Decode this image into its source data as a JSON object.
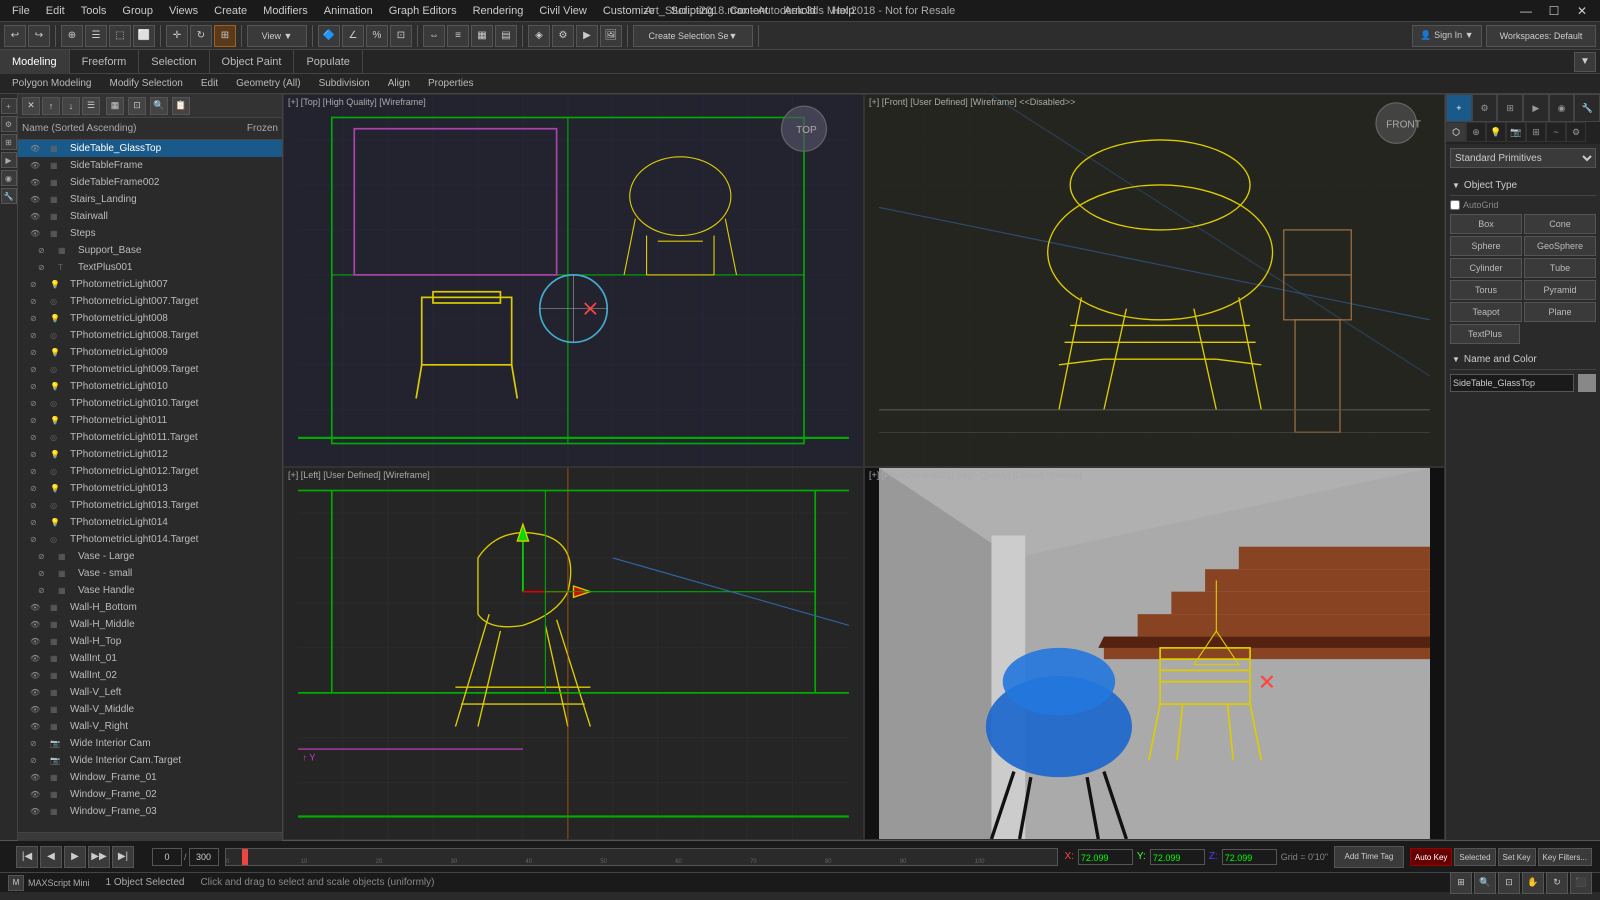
{
  "window": {
    "title": "Art_Studio-2018.max - Autodesk 3ds Max 2018 - Not for Resale",
    "controls": [
      "—",
      "☐",
      "✕"
    ]
  },
  "menu": {
    "items": [
      "File",
      "Edit",
      "Tools",
      "Group",
      "Views",
      "Create",
      "Modifiers",
      "Animation",
      "Graph Editors",
      "Rendering",
      "Civil View",
      "Customize",
      "Scripting",
      "Content",
      "Arnold",
      "Help"
    ]
  },
  "toolbar1": {
    "workspace_label": "Workspaces: Default",
    "sign_in": "Sign In"
  },
  "toolbar2": {
    "tabs": [
      "Modeling",
      "Freeform",
      "Selection",
      "Object Paint",
      "Populate"
    ]
  },
  "toolbar3": {
    "tabs": [
      "Polygon Modeling",
      "Modify Selection",
      "Edit",
      "Geometry (All)",
      "Subdivision",
      "Align",
      "Properties"
    ]
  },
  "scene_list": {
    "header_buttons": [
      "X",
      "↑",
      "↓",
      "📋"
    ],
    "columns": [
      "Name (Sorted Ascending)",
      "Frozen"
    ],
    "items": [
      {
        "name": "SideTable_GlassTop",
        "depth": 1,
        "visible": true,
        "frozen": false,
        "type": "mesh"
      },
      {
        "name": "SideTableFrame",
        "depth": 1,
        "visible": true,
        "frozen": false,
        "type": "mesh"
      },
      {
        "name": "SideTableFrame002",
        "depth": 1,
        "visible": true,
        "frozen": false,
        "type": "mesh"
      },
      {
        "name": "Stairs_Landing",
        "depth": 1,
        "visible": true,
        "frozen": false,
        "type": "mesh"
      },
      {
        "name": "Stairwall",
        "depth": 1,
        "visible": true,
        "frozen": false,
        "type": "mesh"
      },
      {
        "name": "Steps",
        "depth": 1,
        "visible": true,
        "frozen": false,
        "type": "mesh"
      },
      {
        "name": "Support_Base",
        "depth": 2,
        "visible": false,
        "frozen": false,
        "type": "mesh"
      },
      {
        "name": "TextPlus001",
        "depth": 2,
        "visible": false,
        "frozen": false,
        "type": "text"
      },
      {
        "name": "TPhotometricLight007",
        "depth": 1,
        "visible": false,
        "frozen": false,
        "type": "light"
      },
      {
        "name": "TPhotometricLight007.Target",
        "depth": 1,
        "visible": false,
        "frozen": false,
        "type": "target"
      },
      {
        "name": "TPhotometricLight008",
        "depth": 1,
        "visible": false,
        "frozen": false,
        "type": "light"
      },
      {
        "name": "TPhotometricLight008.Target",
        "depth": 1,
        "visible": false,
        "frozen": false,
        "type": "target"
      },
      {
        "name": "TPhotometricLight009",
        "depth": 1,
        "visible": false,
        "frozen": false,
        "type": "light"
      },
      {
        "name": "TPhotometricLight009.Target",
        "depth": 1,
        "visible": false,
        "frozen": false,
        "type": "target"
      },
      {
        "name": "TPhotometricLight010",
        "depth": 1,
        "visible": false,
        "frozen": false,
        "type": "light"
      },
      {
        "name": "TPhotometricLight010.Target",
        "depth": 1,
        "visible": false,
        "frozen": false,
        "type": "target"
      },
      {
        "name": "TPhotometricLight011",
        "depth": 1,
        "visible": false,
        "frozen": false,
        "type": "light"
      },
      {
        "name": "TPhotometricLight011.Target",
        "depth": 1,
        "visible": false,
        "frozen": false,
        "type": "target"
      },
      {
        "name": "TPhotometricLight012",
        "depth": 1,
        "visible": false,
        "frozen": false,
        "type": "light"
      },
      {
        "name": "TPhotometricLight012.Target",
        "depth": 1,
        "visible": false,
        "frozen": false,
        "type": "target"
      },
      {
        "name": "TPhotometricLight013",
        "depth": 1,
        "visible": false,
        "frozen": false,
        "type": "light"
      },
      {
        "name": "TPhotometricLight013.Target",
        "depth": 1,
        "visible": false,
        "frozen": false,
        "type": "target"
      },
      {
        "name": "TPhotometricLight014",
        "depth": 1,
        "visible": false,
        "frozen": false,
        "type": "light"
      },
      {
        "name": "TPhotometricLight014.Target",
        "depth": 1,
        "visible": false,
        "frozen": false,
        "type": "target"
      },
      {
        "name": "Vase - Large",
        "depth": 2,
        "visible": false,
        "frozen": false,
        "type": "mesh"
      },
      {
        "name": "Vase - small",
        "depth": 2,
        "visible": false,
        "frozen": false,
        "type": "mesh"
      },
      {
        "name": "Vase Handle",
        "depth": 2,
        "visible": false,
        "frozen": false,
        "type": "mesh"
      },
      {
        "name": "Wall-H_Bottom",
        "depth": 1,
        "visible": true,
        "frozen": false,
        "type": "mesh"
      },
      {
        "name": "Wall-H_Middle",
        "depth": 1,
        "visible": true,
        "frozen": false,
        "type": "mesh"
      },
      {
        "name": "Wall-H_Top",
        "depth": 1,
        "visible": true,
        "frozen": false,
        "type": "mesh"
      },
      {
        "name": "WallInt_01",
        "depth": 1,
        "visible": true,
        "frozen": false,
        "type": "mesh"
      },
      {
        "name": "WallInt_02",
        "depth": 1,
        "visible": true,
        "frozen": false,
        "type": "mesh"
      },
      {
        "name": "Wall-V_Left",
        "depth": 1,
        "visible": true,
        "frozen": false,
        "type": "mesh"
      },
      {
        "name": "Wall-V_Middle",
        "depth": 1,
        "visible": true,
        "frozen": false,
        "type": "mesh"
      },
      {
        "name": "Wall-V_Right",
        "depth": 1,
        "visible": true,
        "frozen": false,
        "type": "mesh"
      },
      {
        "name": "Wide Interior Cam",
        "depth": 1,
        "visible": false,
        "frozen": false,
        "type": "camera"
      },
      {
        "name": "Wide Interior Cam.Target",
        "depth": 1,
        "visible": false,
        "frozen": false,
        "type": "camera"
      },
      {
        "name": "Window_Frame_01",
        "depth": 1,
        "visible": true,
        "frozen": false,
        "type": "mesh"
      },
      {
        "name": "Window_Frame_02",
        "depth": 1,
        "visible": true,
        "frozen": false,
        "type": "mesh"
      },
      {
        "name": "Window_Frame_03",
        "depth": 1,
        "visible": true,
        "frozen": false,
        "type": "mesh"
      }
    ]
  },
  "viewports": {
    "top_left": {
      "label": "[+] [Top] [High Quality] [Wireframe]",
      "type": "top"
    },
    "top_right": {
      "label": "[+] [Front] [User Defined] [Wireframe] <<Disabled>>",
      "type": "front"
    },
    "bot_left": {
      "label": "[+] [Left] [User Defined] [Wireframe]",
      "type": "left"
    },
    "bot_right": {
      "label": "[+] [PhysCamera001] [High Quality] [Default Shading]",
      "type": "camera"
    }
  },
  "right_panel": {
    "section_standard_primitives": "Standard Primitives",
    "section_object_type": "Object Type",
    "autogrid": "AutoGrid",
    "object_types": [
      "Box",
      "Cone",
      "Sphere",
      "GeoSphere",
      "Cylinder",
      "Tube",
      "Torus",
      "Pyramid",
      "Teapot",
      "Plane",
      "TextPlus"
    ],
    "section_name_color": "Name and Color",
    "selected_name": "SideTable_GlassTop"
  },
  "status_bar": {
    "selection_info": "1 Object Selected",
    "hint": "Click and drag to select and scale objects (uniformly)",
    "x_label": "X:",
    "x_value": "72.099",
    "y_label": "Y:",
    "y_value": "72.099",
    "z_label": "Z:",
    "z_value": "72.099",
    "grid_label": "Grid =",
    "grid_value": "0'10\"",
    "time_label": "0 / 300"
  },
  "playback": {
    "time_start": "0",
    "time_end": "300",
    "buttons": [
      "⏮",
      "◀",
      "▶",
      "▶▶",
      "⏭"
    ],
    "auto_key": "Auto Key",
    "selected": "Selected",
    "set_key": "Set Key",
    "key_filters": "Key Filters..."
  }
}
